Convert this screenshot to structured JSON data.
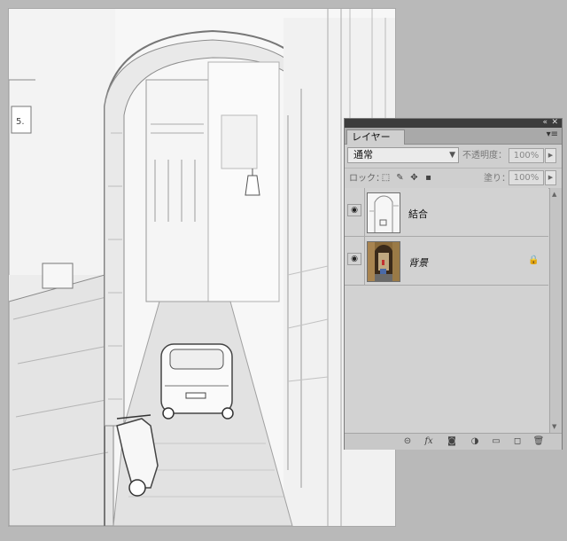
{
  "canvas": {
    "description_name": "pencil-sketch-alley"
  },
  "layers_panel": {
    "tab_label": "レイヤー",
    "blend_mode": "通常",
    "opacity_label": "不透明度：",
    "opacity_value": "100%",
    "lock_label": "ロック：",
    "fill_label": "塗り：",
    "fill_value": "100%",
    "layers": [
      {
        "name": "結合",
        "visible": true,
        "locked": false
      },
      {
        "name": "背景",
        "visible": true,
        "locked": true
      }
    ]
  },
  "icons": {
    "collapse": "«",
    "close": "✕",
    "menu": "▾≡",
    "eye": "◉",
    "lock": "🔒"
  }
}
